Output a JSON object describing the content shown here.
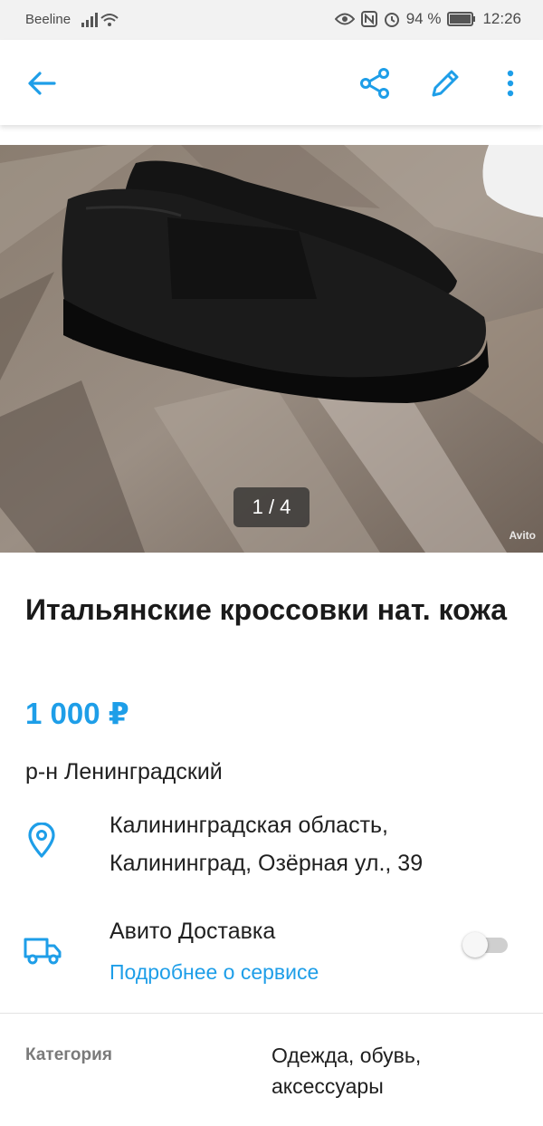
{
  "status_bar": {
    "carrier": "Beeline",
    "battery": "94 %",
    "time": "12:26"
  },
  "app_bar": {
    "icons": [
      "back-arrow-icon",
      "share-icon",
      "edit-icon",
      "more-vert-icon"
    ],
    "accent": "#1e9ee8"
  },
  "gallery": {
    "counter": "1 / 4",
    "watermark": "Avito"
  },
  "listing": {
    "title": "Итальянские кроссовки нат. кожа",
    "price": "1 000 ₽",
    "district": "р-н Ленинградский",
    "address": "Калининградская область, Калининград, Озёрная ул., 39"
  },
  "delivery": {
    "title": "Авито Доставка",
    "link": "Подробнее о сервисе",
    "enabled": false
  },
  "params": {
    "category_label": "Категория",
    "category_value": "Одежда, обувь, аксессуары"
  }
}
